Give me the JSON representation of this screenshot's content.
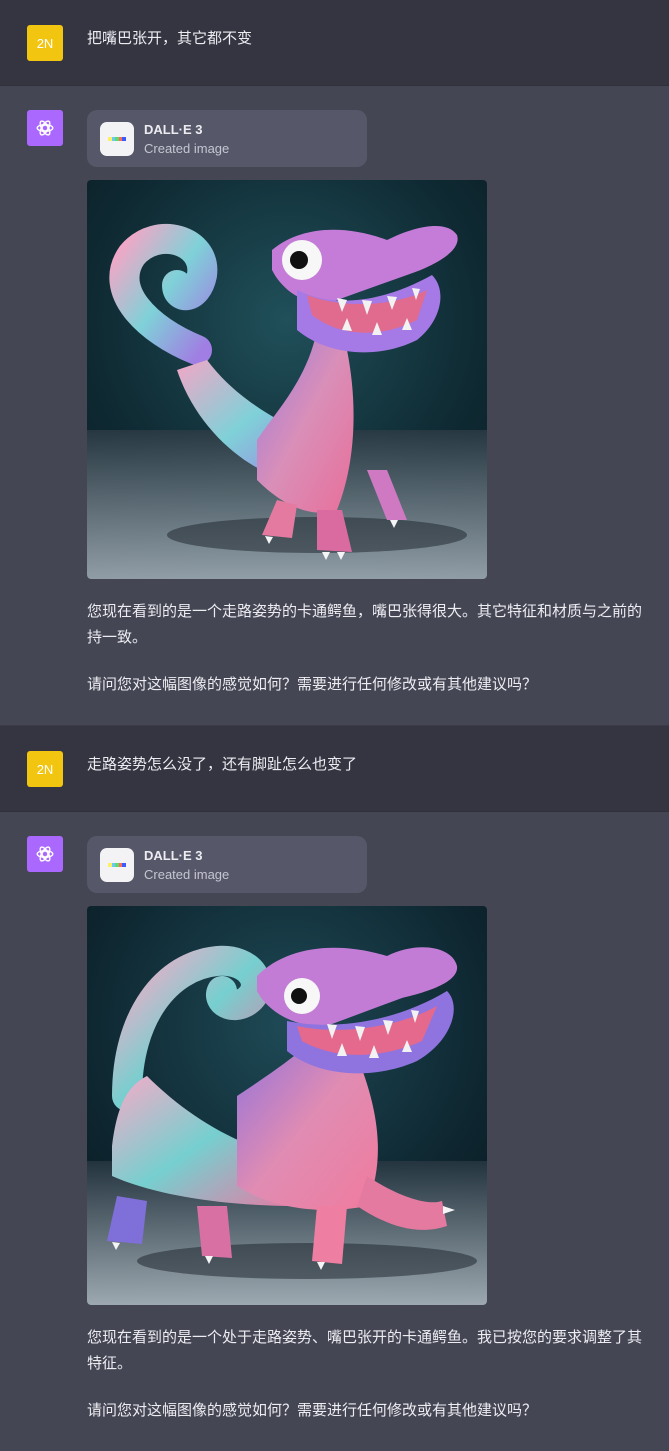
{
  "messages": [
    {
      "role": "user",
      "avatar_initials": "2N",
      "text": "把嘴巴张开，其它都不变"
    },
    {
      "role": "assistant",
      "tool": {
        "name": "DALL·E 3",
        "status": "Created image",
        "icon": "dalle-icon"
      },
      "image_alt": "generated-image",
      "paragraphs": [
        {
          "lines": [
            "您现在看到的是一个走路姿势的卡通鳄鱼，嘴巴张得很大。其它特征和材质与之前的",
            "持一致。"
          ]
        },
        {
          "lines": [
            "请问您对这幅图像的感觉如何？需要进行任何修改或有其他建议吗？"
          ]
        }
      ]
    },
    {
      "role": "user",
      "avatar_initials": "2N",
      "text": "走路姿势怎么没了，还有脚趾怎么也变了"
    },
    {
      "role": "assistant",
      "tool": {
        "name": "DALL·E 3",
        "status": "Created image",
        "icon": "dalle-icon"
      },
      "image_alt": "generated-image",
      "paragraphs": [
        {
          "lines": [
            "您现在看到的是一个处于走路姿势、嘴巴张开的卡通鳄鱼。我已按您的要求调整了其",
            "特征。"
          ]
        },
        {
          "lines": [
            "请问您对这幅图像的感觉如何？需要进行任何修改或有其他建议吗？"
          ]
        }
      ]
    }
  ],
  "colors": {
    "user_bg": "#343541",
    "assistant_bg": "#444654",
    "user_avatar": "#f2c511",
    "assistant_avatar": "#ab68ff",
    "tool_card": "#565869"
  }
}
